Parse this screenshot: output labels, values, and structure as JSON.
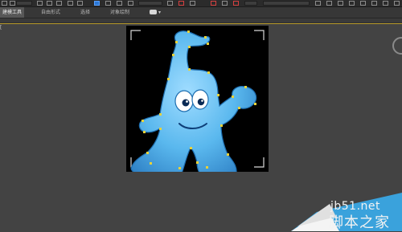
{
  "ribbon": {
    "tabs": [
      "建模工具",
      "自由形式",
      "选择",
      "对象绘制"
    ],
    "active_tab_index": 0
  },
  "viewport": {
    "label": "[",
    "border_color": "#b89a2a",
    "background": "#434343"
  },
  "watermark": {
    "url": "jb51.net",
    "site": "脚本之家"
  },
  "colors": {
    "figure_body": "#5ab8ee",
    "figure_outline": "#1e6eb0",
    "vertex": "#e8d23a",
    "accent_blue": "#2b78d6"
  },
  "icons": [
    "undo-icon",
    "redo-icon",
    "link-icon",
    "select-icon",
    "move-icon",
    "snap-icon",
    "mirror-icon",
    "align-icon"
  ]
}
